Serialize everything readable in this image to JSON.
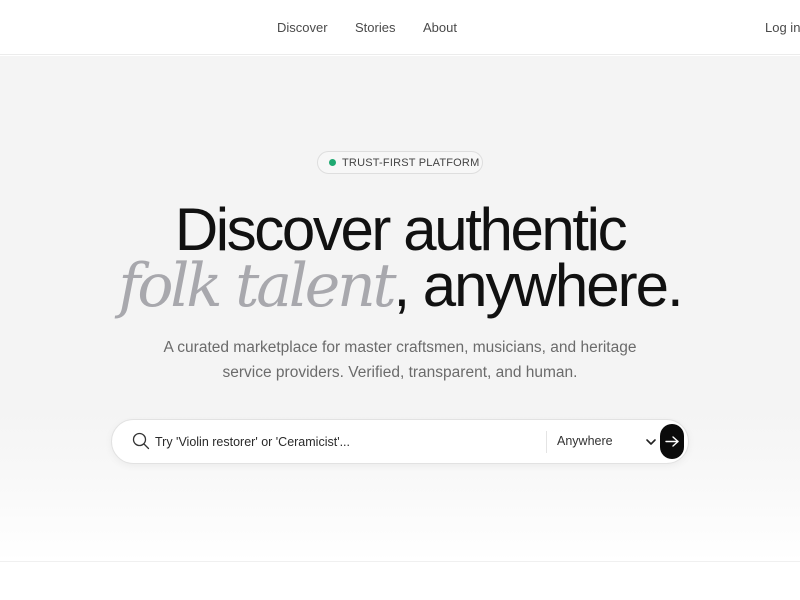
{
  "nav": {
    "links": [
      "Discover",
      "Stories",
      "About"
    ],
    "login_label": "Log in"
  },
  "hero": {
    "badge_label": "TRUST-FIRST PLATFORM",
    "headline_line1": "Discover authentic",
    "headline_accent": "folk talent",
    "headline_rest": ", anywhere.",
    "subtitle": "A curated marketplace for master craftsmen, musicians, and heritage service providers. Verified, transparent, and human."
  },
  "search": {
    "placeholder": "Try 'Violin restorer' or 'Ceramicist'...",
    "value": "",
    "location_selected": "Anywhere",
    "icon": "search-icon",
    "submit_icon": "arrow-right-icon"
  },
  "colors": {
    "accent_text": "#a8a8ad",
    "status_dot": "#1fa971",
    "button": "#0b0b0b",
    "hero_background": "#f4f4f4"
  }
}
